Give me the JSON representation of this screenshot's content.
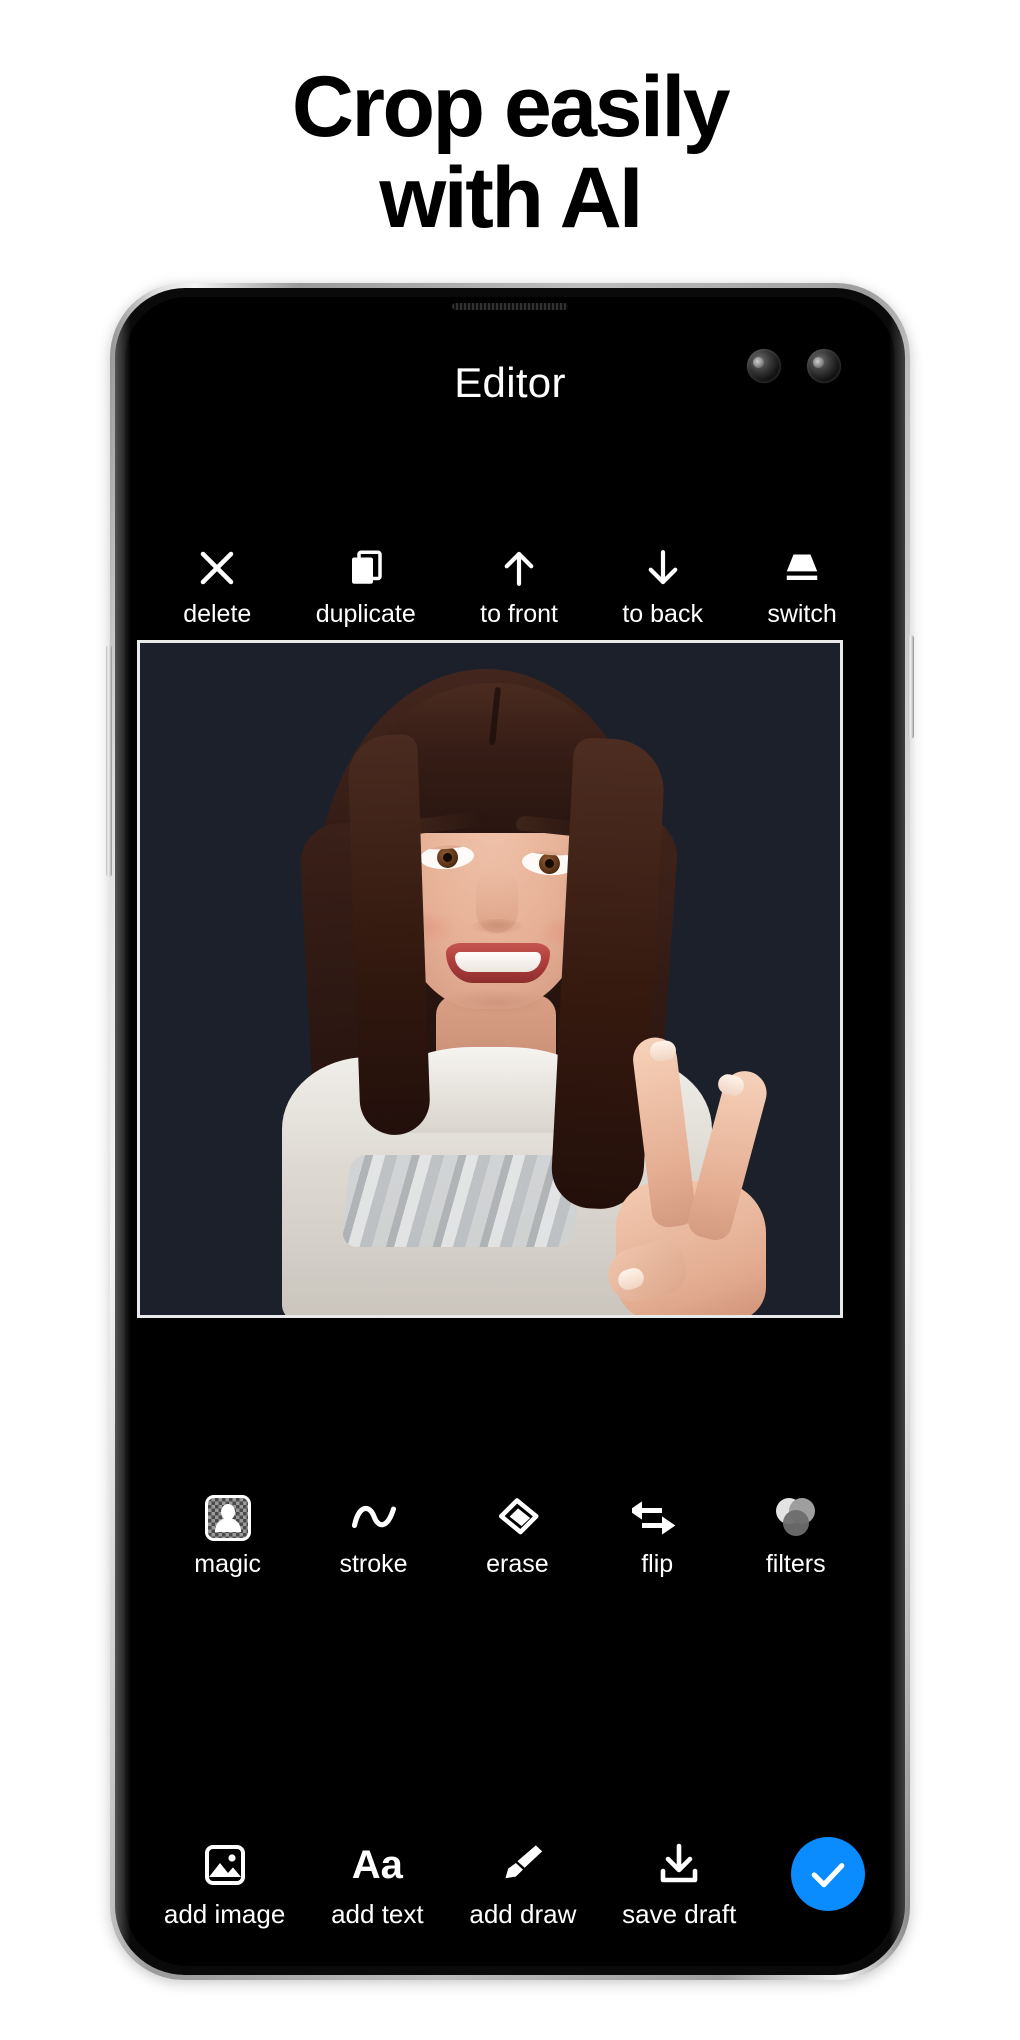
{
  "headline": "Crop easily\nwith AI",
  "app": {
    "title": "Editor",
    "top_toolbar": [
      {
        "icon": "close-x-icon",
        "label": "delete"
      },
      {
        "icon": "duplicate-icon",
        "label": "duplicate"
      },
      {
        "icon": "arrow-up-icon",
        "label": "to front"
      },
      {
        "icon": "arrow-down-icon",
        "label": "to back"
      },
      {
        "icon": "switch-layer-icon",
        "label": "switch"
      }
    ],
    "mid_toolbar": [
      {
        "icon": "magic-cutout-icon",
        "label": "magic"
      },
      {
        "icon": "wavy-stroke-icon",
        "label": "stroke"
      },
      {
        "icon": "eraser-icon",
        "label": "erase"
      },
      {
        "icon": "flip-arrows-icon",
        "label": "flip"
      },
      {
        "icon": "filters-circles-icon",
        "label": "filters"
      }
    ],
    "bottom_toolbar": [
      {
        "icon": "image-icon",
        "label": "add image"
      },
      {
        "icon": "text-aa-icon",
        "label": "add text"
      },
      {
        "icon": "paintbrush-icon",
        "label": "add draw"
      },
      {
        "icon": "download-icon",
        "label": "save draft"
      }
    ],
    "confirm_button": {
      "icon": "check-icon",
      "label": ""
    },
    "canvas": {
      "subject": "woman smiling making peace sign",
      "background_color": "#1b202b",
      "selection_border_color": "#e9e9ea"
    }
  },
  "colors": {
    "accent": "#0a8cff",
    "screen_bg": "#000000",
    "canvas_bg": "#1b202b",
    "text": "#ffffff",
    "headline": "#000000",
    "page_bg": "#ffffff"
  }
}
